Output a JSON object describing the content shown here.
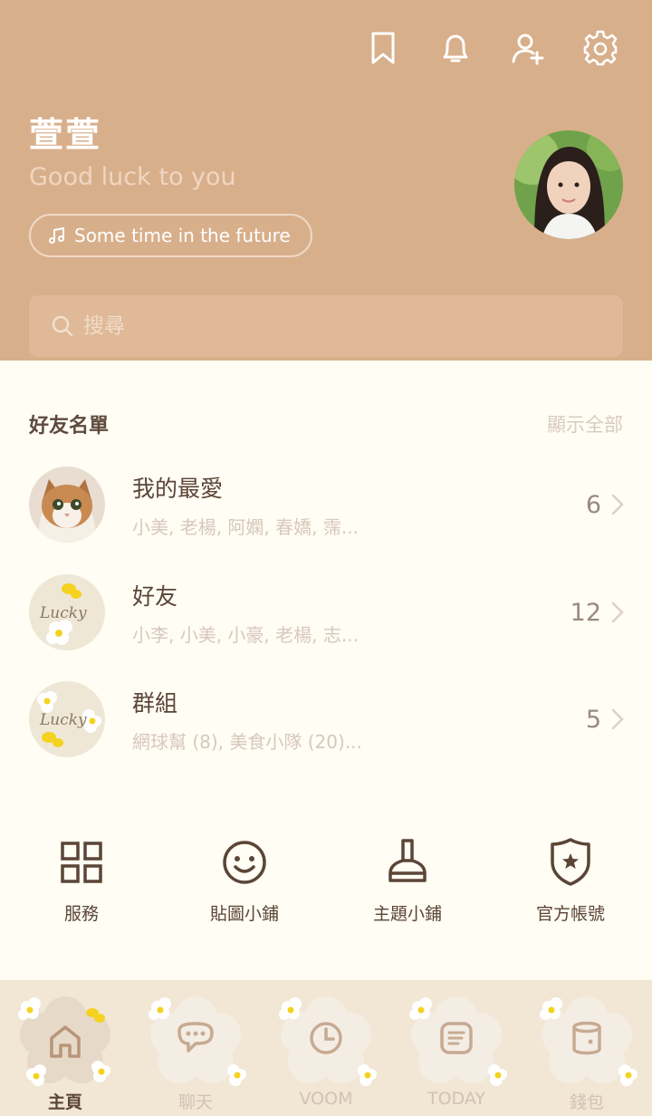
{
  "header": {
    "profile_name": "萱萱",
    "status_message": "Good luck to you",
    "music": "Some time in the future",
    "icons": [
      "bookmark-icon",
      "bell-icon",
      "add-friend-icon",
      "gear-icon"
    ]
  },
  "search": {
    "placeholder": "搜尋"
  },
  "friends_section": {
    "title": "好友名單",
    "show_all": "顯示全部",
    "rows": [
      {
        "title": "我的最愛",
        "subtitle": "小美, 老楊, 阿嫻, 春嬌, 霈...",
        "count": "6"
      },
      {
        "title": "好友",
        "subtitle": "小李, 小美, 小豪, 老楊, 志...",
        "count": "12"
      },
      {
        "title": "群組",
        "subtitle": "網球幫 (8), 美食小隊 (20)...",
        "count": "5"
      }
    ]
  },
  "services": [
    {
      "label": "服務",
      "icon": "grid-icon"
    },
    {
      "label": "貼圖小鋪",
      "icon": "smiley-icon"
    },
    {
      "label": "主題小鋪",
      "icon": "brush-icon"
    },
    {
      "label": "官方帳號",
      "icon": "shield-star-icon"
    }
  ],
  "bottom_nav": [
    {
      "label": "主頁",
      "icon": "home-icon",
      "active": true
    },
    {
      "label": "聊天",
      "icon": "chat-icon",
      "active": false
    },
    {
      "label": "VOOM",
      "icon": "clock-icon",
      "active": false
    },
    {
      "label": "TODAY",
      "icon": "news-icon",
      "active": false
    },
    {
      "label": "錢包",
      "icon": "wallet-icon",
      "active": false
    }
  ],
  "colors": {
    "header_bg": "#d8af8b",
    "body_bg": "#fffdf4",
    "nav_bg": "#f2e6d5",
    "text_dark": "#5b4536",
    "text_muted": "#d8c8bc"
  }
}
